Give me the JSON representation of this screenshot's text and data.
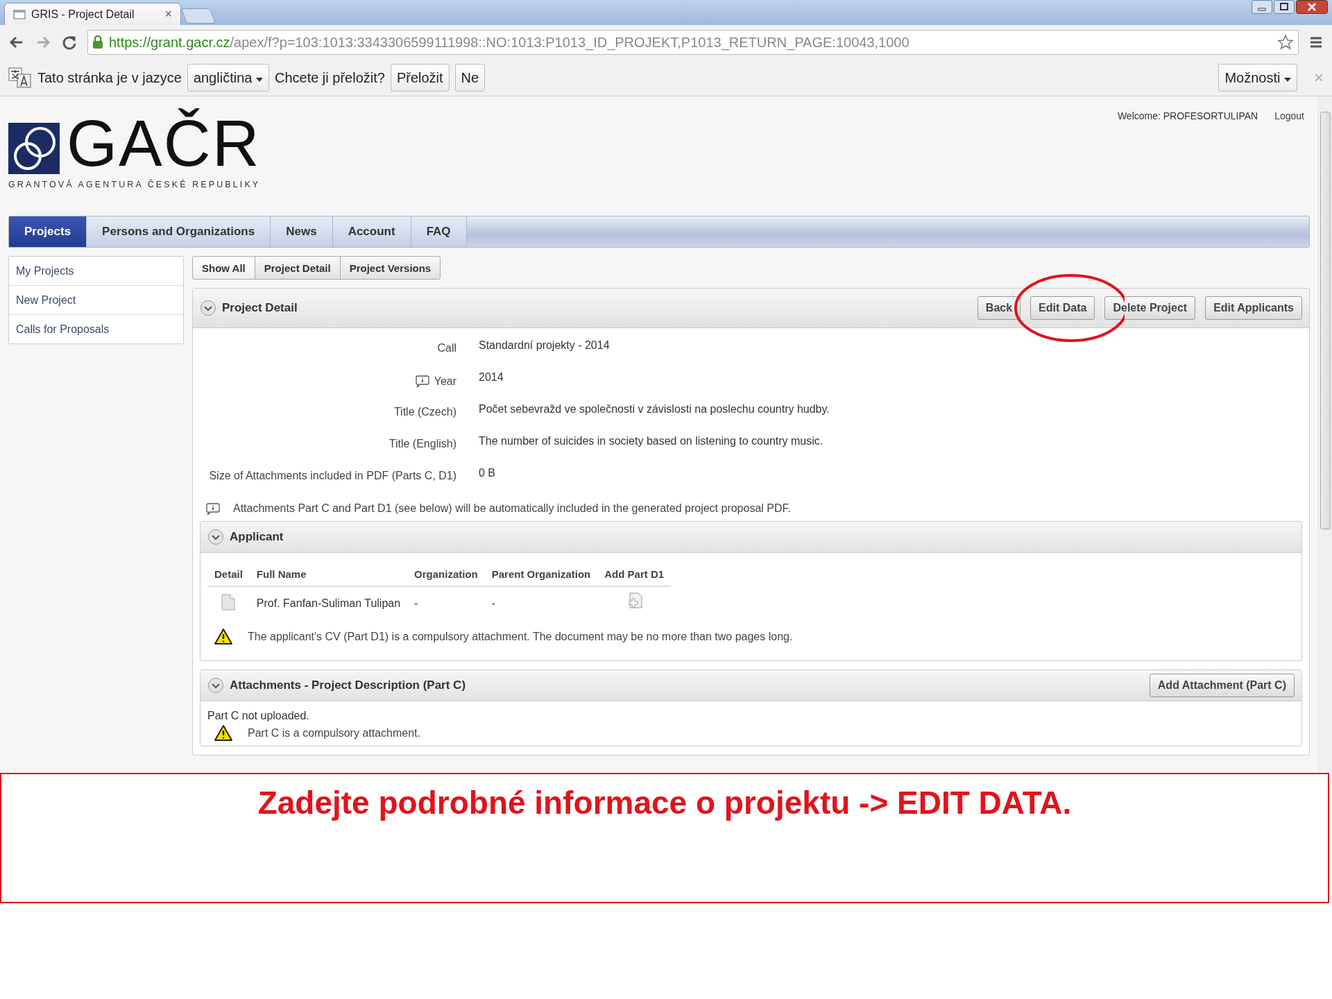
{
  "browser": {
    "tab_title": "GRIS - Project Detail",
    "tab_close": "×",
    "url_secure": "https://grant.gacr.cz",
    "url_path": "/apex/f?p=103:1013:3343306599111998::NO:1013:P1013_ID_PROJEKT,P1013_RETURN_PAGE:10043,1000"
  },
  "translate_bar": {
    "message": "Tato stránka je v jazyce",
    "language": "angličtina",
    "question": "Chcete ji přeložit?",
    "buttons": [
      "Přeložit",
      "Ne"
    ],
    "options": "Možnosti",
    "close": "×"
  },
  "header": {
    "welcome": "Welcome: PROFESORTULIPAN",
    "logout": "Logout",
    "logo_text": "GAČR",
    "logo_subtitle": "GRANTOVÁ AGENTURA ČESKÉ REPUBLIKY"
  },
  "nav_tabs": [
    {
      "label": "Projects",
      "selected": true
    },
    {
      "label": "Persons and Organizations",
      "selected": false
    },
    {
      "label": "News",
      "selected": false
    },
    {
      "label": "Account",
      "selected": false
    },
    {
      "label": "FAQ",
      "selected": false
    }
  ],
  "sidebar": {
    "items": [
      "My Projects",
      "New Project",
      "Calls for Proposals"
    ]
  },
  "sub_tabs": [
    "Show All",
    "Project Detail",
    "Project Versions"
  ],
  "project_detail": {
    "title": "Project Detail",
    "buttons": [
      "Back",
      "Edit Data",
      "Delete Project",
      "Edit Applicants"
    ],
    "fields": [
      {
        "label": "Call",
        "value": "Standardní projekty - 2014",
        "info": false
      },
      {
        "label": "Year",
        "value": "2014",
        "info": true
      },
      {
        "label": "Title (Czech)",
        "value": "Počet sebevražd ve společnosti v závislosti na poslechu country hudby.",
        "info": false
      },
      {
        "label": "Title (English)",
        "value": "The number of suicides in society based on listening to country music.",
        "info": false
      },
      {
        "label": "Size of Attachments included in PDF (Parts C, D1)",
        "value": "0 B",
        "info": false
      }
    ],
    "note": "Attachments Part C and Part D1 (see below) will be automatically included in the generated project proposal PDF."
  },
  "applicant": {
    "title": "Applicant",
    "columns": [
      "Detail",
      "Full Name",
      "Organization",
      "Parent Organization",
      "Add Part D1"
    ],
    "rows": [
      {
        "full_name": "Prof. Fanfan-Suliman Tulipan",
        "organization": "-",
        "parent_organization": "-"
      }
    ],
    "warning": "The applicant's CV (Part D1) is a compulsory attachment. The document may be no more than two pages long."
  },
  "attachments": {
    "title": "Attachments - Project Description (Part C)",
    "button": "Add Attachment (Part C)",
    "status": "Part C not uploaded.",
    "warning": "Part C is a compulsory attachment."
  },
  "caption": "Zadejte podrobné informace o projektu -> EDIT DATA."
}
